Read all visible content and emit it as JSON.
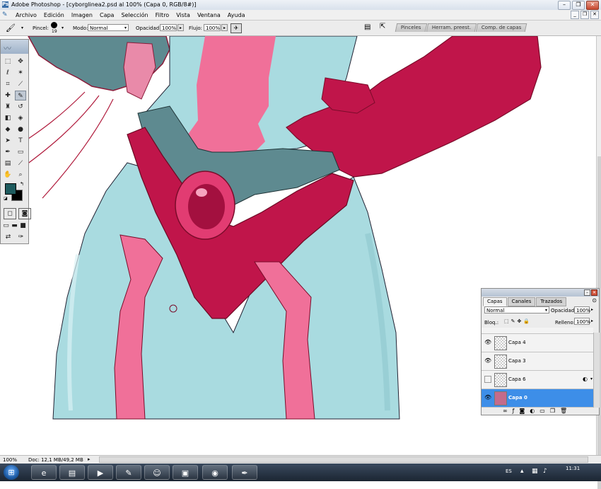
{
  "window": {
    "title": "Adobe Photoshop - [cyborglinea2.psd al 100% (Capa 0, RGB/8#)]",
    "minimize_icon": "minimize-icon",
    "restore_icon": "restore-icon",
    "close_icon": "close-icon"
  },
  "menu": [
    "Archivo",
    "Edición",
    "Imagen",
    "Capa",
    "Selección",
    "Filtro",
    "Vista",
    "Ventana",
    "Ayuda"
  ],
  "options": {
    "brush_label": "Pincel:",
    "brush_size": "19",
    "mode_label": "Modo:",
    "mode_value": "Normal",
    "opacity_label": "Opacidad:",
    "opacity_value": "100%",
    "flow_label": "Flujo:",
    "flow_value": "100%"
  },
  "palette_well": [
    "Pinceles",
    "Herram. preest.",
    "Comp. de capas"
  ],
  "toolbox": {
    "foreground_color": "#1e5b5e",
    "background_color": "#000000"
  },
  "layers_panel": {
    "tabs": [
      "Capas",
      "Canales",
      "Trazados"
    ],
    "blend_mode": "Normal",
    "opacity_label": "Opacidad:",
    "opacity_value": "100%",
    "lock_label": "Bloq.:",
    "fill_label": "Relleno:",
    "fill_value": "100%",
    "layers": [
      {
        "name": "Capa 4",
        "visible": true,
        "selected": false
      },
      {
        "name": "Capa 3",
        "visible": true,
        "selected": false
      },
      {
        "name": "Capa 6",
        "visible": false,
        "selected": false
      },
      {
        "name": "Capa 0",
        "visible": true,
        "selected": true
      }
    ]
  },
  "status": {
    "zoom": "100%",
    "doc": "Doc: 12,1 MB/49,2 MB"
  },
  "taskbar": {
    "language": "ES",
    "time": "11:31"
  },
  "colors": {
    "suit_light": "#a9dbe0",
    "suit_pink": "#f07099",
    "suit_crimson": "#c0154a",
    "suit_gray": "#5e8a90",
    "selected_layer": "#3d8ee8"
  }
}
